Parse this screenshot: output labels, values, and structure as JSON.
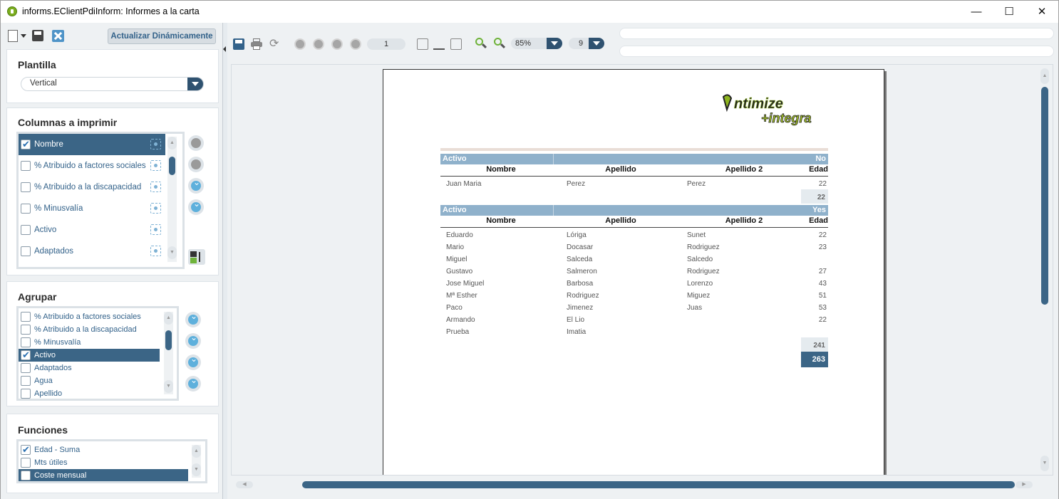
{
  "window": {
    "title": "informs.EClientPdiInform: Informes a la carta"
  },
  "left": {
    "update_button": "Actualizar Dinámicamente",
    "template": {
      "title": "Plantilla",
      "value": "Vertical"
    },
    "columns": {
      "title": "Columnas a imprimir",
      "items": [
        {
          "label": "Nombre",
          "checked": true,
          "selected": true
        },
        {
          "label": "% Atribuido a factores sociales",
          "checked": false,
          "selected": false
        },
        {
          "label": "% Atribuido a la discapacidad",
          "checked": false,
          "selected": false
        },
        {
          "label": "% Minusvalía",
          "checked": false,
          "selected": false
        },
        {
          "label": "Activo",
          "checked": false,
          "selected": false
        },
        {
          "label": "Adaptados",
          "checked": false,
          "selected": false
        }
      ]
    },
    "group": {
      "title": "Agrupar",
      "items": [
        {
          "label": "% Atribuido a factores sociales",
          "checked": false,
          "selected": false
        },
        {
          "label": "% Atribuido a la discapacidad",
          "checked": false,
          "selected": false
        },
        {
          "label": "% Minusvalía",
          "checked": false,
          "selected": false
        },
        {
          "label": "Activo",
          "checked": true,
          "selected": true
        },
        {
          "label": "Adaptados",
          "checked": false,
          "selected": false
        },
        {
          "label": "Agua",
          "checked": false,
          "selected": false
        },
        {
          "label": "Apellido",
          "checked": false,
          "selected": false
        }
      ]
    },
    "functions": {
      "title": "Funciones",
      "items": [
        {
          "label": "Edad - Suma",
          "checked": true,
          "selected": false
        },
        {
          "label": "Mts útiles",
          "checked": false,
          "selected": false
        },
        {
          "label": "Coste mensual",
          "checked": false,
          "selected": true
        }
      ]
    }
  },
  "viewer": {
    "page_number": "1",
    "zoom": "85%",
    "page_count": "9"
  },
  "report": {
    "logo_top": "ntimize",
    "logo_bottom": "+integra",
    "headers": [
      "Nombre",
      "Apellido",
      "Apellido 2",
      "Edad"
    ],
    "groups": [
      {
        "label": "Activo",
        "value": "No",
        "rows": [
          [
            "Juan Maria",
            "Perez",
            "Perez",
            "22"
          ]
        ],
        "subtotal": "22"
      },
      {
        "label": "Activo",
        "value": "Yes",
        "rows": [
          [
            "Eduardo",
            "Lóriga",
            "Sunet",
            "22"
          ],
          [
            "Mario",
            "Docasar",
            "Rodriguez",
            "23"
          ],
          [
            "Miguel",
            "Salceda",
            "Salcedo",
            ""
          ],
          [
            "Gustavo",
            "Salmeron",
            "Rodriguez",
            "27"
          ],
          [
            "Jose Miguel",
            "Barbosa",
            "Lorenzo",
            "43"
          ],
          [
            "Mª Esther",
            "Rodriguez",
            "Miguez",
            "51"
          ],
          [
            "Paco",
            "Jimenez",
            "Juas",
            "53"
          ],
          [
            "Armando",
            "El Lio",
            "",
            "22"
          ],
          [
            "Prueba",
            "Imatia",
            "",
            ""
          ]
        ],
        "subtotal": "241"
      }
    ],
    "grand_total": "263"
  }
}
